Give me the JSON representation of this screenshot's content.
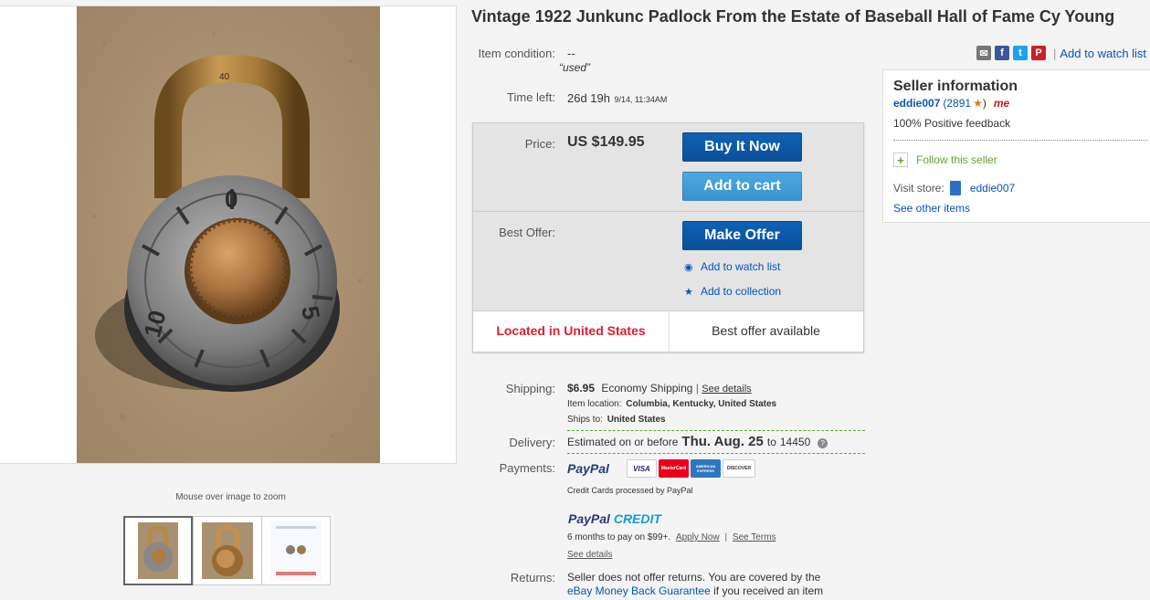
{
  "title": "Vintage 1922 Junkunc Padlock From the Estate of Baseball Hall of Fame Cy Young",
  "gallery": {
    "zoom_hint": "Mouse over image to zoom",
    "lock_numbers": {
      "top": "0",
      "left": "10",
      "right": "5",
      "shackle_stamp": "40"
    }
  },
  "condition": {
    "label": "Item condition:",
    "value": "--",
    "quote": "“used”"
  },
  "time_left": {
    "label": "Time left:",
    "value": "26d 19h",
    "end": "9/14, 11:34AM"
  },
  "buybox": {
    "price_label": "Price:",
    "price": "US $149.95",
    "buy_now": "Buy It Now",
    "add_to_cart": "Add to cart",
    "best_offer_label": "Best Offer:",
    "make_offer": "Make Offer",
    "add_watch": "Add to watch list",
    "add_collection": "Add to collection",
    "located": "Located in United States",
    "best_offer_available": "Best offer available"
  },
  "share": {
    "add_watch": "Add to watch list"
  },
  "seller": {
    "heading": "Seller information",
    "name": "eddie007",
    "score": "(2891",
    "score_close": ")",
    "me_badge": "me",
    "feedback": "100% Positive feedback",
    "follow": "Follow this seller",
    "visit_store_label": "Visit store:",
    "store_name": "eddie007",
    "other_items": "See other items"
  },
  "shipping": {
    "label": "Shipping:",
    "cost": "$6.95",
    "method": "Economy Shipping",
    "details_link": "See details",
    "location_label": "Item location:",
    "location": "Columbia, Kentucky, United States",
    "ships_to_label": "Ships to:",
    "ships_to": "United States"
  },
  "delivery": {
    "label": "Delivery:",
    "prefix": "Estimated on or before",
    "date": "Thu. Aug. 25",
    "to": "to",
    "zip": "14450"
  },
  "payments": {
    "label": "Payments:",
    "paypal": "PayPal",
    "cards": [
      "VISA",
      "MasterCard",
      "AMERICAN EXPRESS",
      "DISCOVER"
    ],
    "processed": "Credit Cards processed by PayPal",
    "credit_logo_a": "PayPal",
    "credit_logo_b": "CREDIT",
    "credit_terms": "6 months to pay on $99+.",
    "apply_now": "Apply Now",
    "see_terms": "See Terms",
    "see_details": "See details"
  },
  "returns": {
    "label": "Returns:",
    "text": "Seller does not offer returns. You are covered by the",
    "guarantee": "eBay Money Back Guarantee",
    "tail": "if you received an item"
  },
  "colors": {
    "ebay_blue": "#0654ba",
    "btn_dark": "#0b5db1",
    "btn_light": "#3d9ad6",
    "located_red": "#dd1e31",
    "green": "#5ba632"
  }
}
